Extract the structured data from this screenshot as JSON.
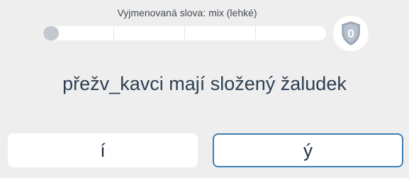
{
  "header": {
    "title": "Vyjmenovaná slova: mix (lehké)"
  },
  "progress": {
    "value": 0,
    "segments": 4
  },
  "score": {
    "value": "0",
    "icon": "shield-icon"
  },
  "question": {
    "text": "přežv_kavci mají složený žaludek"
  },
  "answers": [
    {
      "label": "í"
    },
    {
      "label": "ý"
    }
  ],
  "colors": {
    "background": "#eeeeee",
    "accent": "#3f7fb2",
    "text": "#2e3f53",
    "shield": "#a9b4c2"
  }
}
